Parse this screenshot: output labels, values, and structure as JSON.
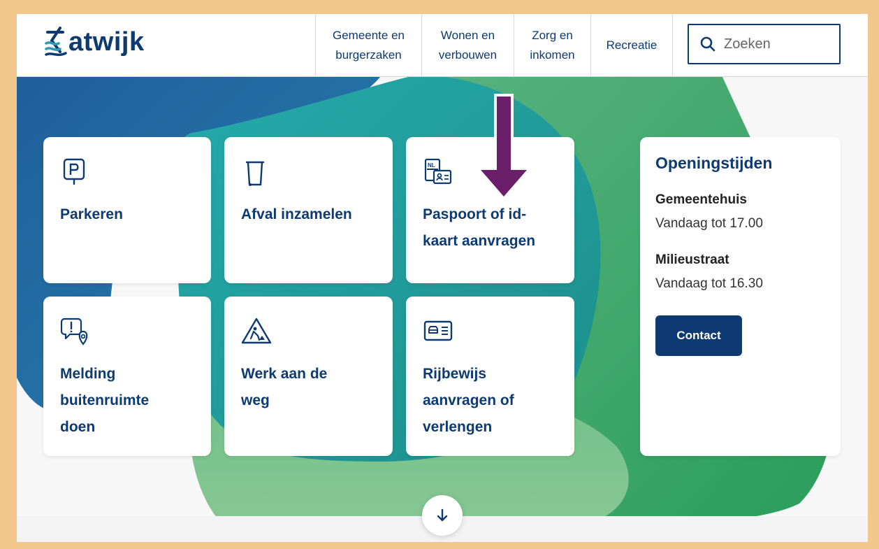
{
  "header": {
    "logo_text": "atwijk",
    "nav": [
      {
        "label": "Gemeente en\nburgerzaken"
      },
      {
        "label": "Wonen en\nverbouwen"
      },
      {
        "label": "Zorg en\ninkomen"
      },
      {
        "label": "Recreatie"
      }
    ],
    "search": {
      "placeholder": "Zoeken"
    }
  },
  "tiles": [
    {
      "label": "Parkeren",
      "icon": "parking-sign-icon"
    },
    {
      "label": "Afval inzamelen",
      "icon": "waste-bin-icon"
    },
    {
      "label": "Paspoort of id-\nkaart aanvragen",
      "icon": "nl-id-card-icon"
    },
    {
      "label": "Melding\nbuitenruimte\ndoen",
      "icon": "report-location-icon"
    },
    {
      "label": "Werk aan de\nweg",
      "icon": "roadwork-sign-icon"
    },
    {
      "label": "Rijbewijs\naanvragen of\nverlengen",
      "icon": "driving-license-icon"
    }
  ],
  "hours": {
    "title": "Openingstijden",
    "locations": [
      {
        "name": "Gemeentehuis",
        "time": "Vandaag tot 17.00"
      },
      {
        "name": "Milieustraat",
        "time": "Vandaag tot 16.30"
      }
    ],
    "contact_label": "Contact"
  },
  "colors": {
    "brand": "#0d3a73",
    "annotation_arrow": "#6b1f6a",
    "frame": "#f3c68c"
  }
}
